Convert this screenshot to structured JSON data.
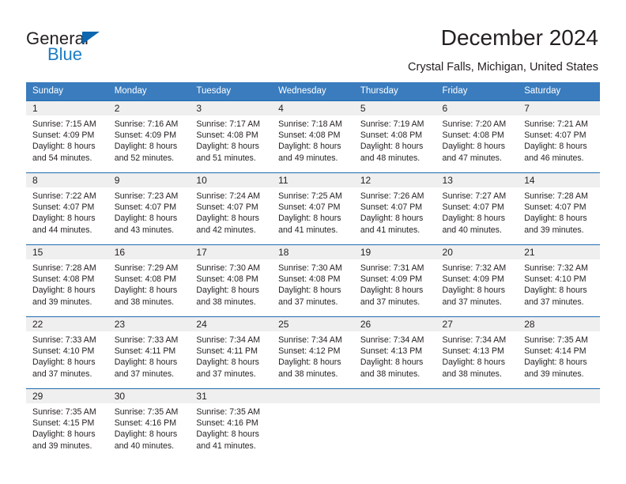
{
  "brand": {
    "name_part1": "General",
    "name_part2": "Blue",
    "triangle_icon": "triangle-icon",
    "color_primary": "#1c7cc4",
    "color_text": "#231f20"
  },
  "header": {
    "title": "December 2024",
    "subtitle": "Crystal Falls, Michigan, United States"
  },
  "calendar": {
    "header_bg": "#3a7cbe",
    "row_divider_color": "#1f6cb0",
    "daynum_band_bg": "#efefef",
    "weekdays": [
      "Sunday",
      "Monday",
      "Tuesday",
      "Wednesday",
      "Thursday",
      "Friday",
      "Saturday"
    ],
    "weeks": [
      [
        {
          "day": "1",
          "sunrise": "Sunrise: 7:15 AM",
          "sunset": "Sunset: 4:09 PM",
          "daylight1": "Daylight: 8 hours",
          "daylight2": "and 54 minutes."
        },
        {
          "day": "2",
          "sunrise": "Sunrise: 7:16 AM",
          "sunset": "Sunset: 4:09 PM",
          "daylight1": "Daylight: 8 hours",
          "daylight2": "and 52 minutes."
        },
        {
          "day": "3",
          "sunrise": "Sunrise: 7:17 AM",
          "sunset": "Sunset: 4:08 PM",
          "daylight1": "Daylight: 8 hours",
          "daylight2": "and 51 minutes."
        },
        {
          "day": "4",
          "sunrise": "Sunrise: 7:18 AM",
          "sunset": "Sunset: 4:08 PM",
          "daylight1": "Daylight: 8 hours",
          "daylight2": "and 49 minutes."
        },
        {
          "day": "5",
          "sunrise": "Sunrise: 7:19 AM",
          "sunset": "Sunset: 4:08 PM",
          "daylight1": "Daylight: 8 hours",
          "daylight2": "and 48 minutes."
        },
        {
          "day": "6",
          "sunrise": "Sunrise: 7:20 AM",
          "sunset": "Sunset: 4:08 PM",
          "daylight1": "Daylight: 8 hours",
          "daylight2": "and 47 minutes."
        },
        {
          "day": "7",
          "sunrise": "Sunrise: 7:21 AM",
          "sunset": "Sunset: 4:07 PM",
          "daylight1": "Daylight: 8 hours",
          "daylight2": "and 46 minutes."
        }
      ],
      [
        {
          "day": "8",
          "sunrise": "Sunrise: 7:22 AM",
          "sunset": "Sunset: 4:07 PM",
          "daylight1": "Daylight: 8 hours",
          "daylight2": "and 44 minutes."
        },
        {
          "day": "9",
          "sunrise": "Sunrise: 7:23 AM",
          "sunset": "Sunset: 4:07 PM",
          "daylight1": "Daylight: 8 hours",
          "daylight2": "and 43 minutes."
        },
        {
          "day": "10",
          "sunrise": "Sunrise: 7:24 AM",
          "sunset": "Sunset: 4:07 PM",
          "daylight1": "Daylight: 8 hours",
          "daylight2": "and 42 minutes."
        },
        {
          "day": "11",
          "sunrise": "Sunrise: 7:25 AM",
          "sunset": "Sunset: 4:07 PM",
          "daylight1": "Daylight: 8 hours",
          "daylight2": "and 41 minutes."
        },
        {
          "day": "12",
          "sunrise": "Sunrise: 7:26 AM",
          "sunset": "Sunset: 4:07 PM",
          "daylight1": "Daylight: 8 hours",
          "daylight2": "and 41 minutes."
        },
        {
          "day": "13",
          "sunrise": "Sunrise: 7:27 AM",
          "sunset": "Sunset: 4:07 PM",
          "daylight1": "Daylight: 8 hours",
          "daylight2": "and 40 minutes."
        },
        {
          "day": "14",
          "sunrise": "Sunrise: 7:28 AM",
          "sunset": "Sunset: 4:07 PM",
          "daylight1": "Daylight: 8 hours",
          "daylight2": "and 39 minutes."
        }
      ],
      [
        {
          "day": "15",
          "sunrise": "Sunrise: 7:28 AM",
          "sunset": "Sunset: 4:08 PM",
          "daylight1": "Daylight: 8 hours",
          "daylight2": "and 39 minutes."
        },
        {
          "day": "16",
          "sunrise": "Sunrise: 7:29 AM",
          "sunset": "Sunset: 4:08 PM",
          "daylight1": "Daylight: 8 hours",
          "daylight2": "and 38 minutes."
        },
        {
          "day": "17",
          "sunrise": "Sunrise: 7:30 AM",
          "sunset": "Sunset: 4:08 PM",
          "daylight1": "Daylight: 8 hours",
          "daylight2": "and 38 minutes."
        },
        {
          "day": "18",
          "sunrise": "Sunrise: 7:30 AM",
          "sunset": "Sunset: 4:08 PM",
          "daylight1": "Daylight: 8 hours",
          "daylight2": "and 37 minutes."
        },
        {
          "day": "19",
          "sunrise": "Sunrise: 7:31 AM",
          "sunset": "Sunset: 4:09 PM",
          "daylight1": "Daylight: 8 hours",
          "daylight2": "and 37 minutes."
        },
        {
          "day": "20",
          "sunrise": "Sunrise: 7:32 AM",
          "sunset": "Sunset: 4:09 PM",
          "daylight1": "Daylight: 8 hours",
          "daylight2": "and 37 minutes."
        },
        {
          "day": "21",
          "sunrise": "Sunrise: 7:32 AM",
          "sunset": "Sunset: 4:10 PM",
          "daylight1": "Daylight: 8 hours",
          "daylight2": "and 37 minutes."
        }
      ],
      [
        {
          "day": "22",
          "sunrise": "Sunrise: 7:33 AM",
          "sunset": "Sunset: 4:10 PM",
          "daylight1": "Daylight: 8 hours",
          "daylight2": "and 37 minutes."
        },
        {
          "day": "23",
          "sunrise": "Sunrise: 7:33 AM",
          "sunset": "Sunset: 4:11 PM",
          "daylight1": "Daylight: 8 hours",
          "daylight2": "and 37 minutes."
        },
        {
          "day": "24",
          "sunrise": "Sunrise: 7:34 AM",
          "sunset": "Sunset: 4:11 PM",
          "daylight1": "Daylight: 8 hours",
          "daylight2": "and 37 minutes."
        },
        {
          "day": "25",
          "sunrise": "Sunrise: 7:34 AM",
          "sunset": "Sunset: 4:12 PM",
          "daylight1": "Daylight: 8 hours",
          "daylight2": "and 38 minutes."
        },
        {
          "day": "26",
          "sunrise": "Sunrise: 7:34 AM",
          "sunset": "Sunset: 4:13 PM",
          "daylight1": "Daylight: 8 hours",
          "daylight2": "and 38 minutes."
        },
        {
          "day": "27",
          "sunrise": "Sunrise: 7:34 AM",
          "sunset": "Sunset: 4:13 PM",
          "daylight1": "Daylight: 8 hours",
          "daylight2": "and 38 minutes."
        },
        {
          "day": "28",
          "sunrise": "Sunrise: 7:35 AM",
          "sunset": "Sunset: 4:14 PM",
          "daylight1": "Daylight: 8 hours",
          "daylight2": "and 39 minutes."
        }
      ],
      [
        {
          "day": "29",
          "sunrise": "Sunrise: 7:35 AM",
          "sunset": "Sunset: 4:15 PM",
          "daylight1": "Daylight: 8 hours",
          "daylight2": "and 39 minutes."
        },
        {
          "day": "30",
          "sunrise": "Sunrise: 7:35 AM",
          "sunset": "Sunset: 4:16 PM",
          "daylight1": "Daylight: 8 hours",
          "daylight2": "and 40 minutes."
        },
        {
          "day": "31",
          "sunrise": "Sunrise: 7:35 AM",
          "sunset": "Sunset: 4:16 PM",
          "daylight1": "Daylight: 8 hours",
          "daylight2": "and 41 minutes."
        },
        {
          "day": "",
          "sunrise": "",
          "sunset": "",
          "daylight1": "",
          "daylight2": ""
        },
        {
          "day": "",
          "sunrise": "",
          "sunset": "",
          "daylight1": "",
          "daylight2": ""
        },
        {
          "day": "",
          "sunrise": "",
          "sunset": "",
          "daylight1": "",
          "daylight2": ""
        },
        {
          "day": "",
          "sunrise": "",
          "sunset": "",
          "daylight1": "",
          "daylight2": ""
        }
      ]
    ]
  }
}
